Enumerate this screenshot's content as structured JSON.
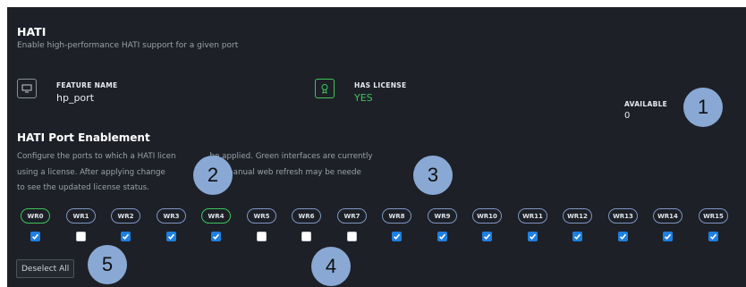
{
  "header": {
    "title": "HATI",
    "subtitle": "Enable high-performance HATI support for a given port"
  },
  "feature": {
    "name_label": "FEATURE NAME",
    "name_value": "hp_port",
    "license_label": "HAS LICENSE",
    "license_value": "YES",
    "available_label": "AVAILABLE",
    "available_value": "0"
  },
  "enablement": {
    "title": "HATI Port Enablement",
    "desc_line1": "Configure the ports to which a HATI licen",
    "desc_line1b": "be applied. Green interfaces are currently",
    "desc_line2": "using a license. After applying change",
    "desc_line2b": "onal manual web refresh may be neede",
    "desc_line3": "to see the updated license status."
  },
  "ports": [
    {
      "label": "WR0",
      "checked": true,
      "licensed": true
    },
    {
      "label": "WR1",
      "checked": false,
      "licensed": false
    },
    {
      "label": "WR2",
      "checked": true,
      "licensed": false
    },
    {
      "label": "WR3",
      "checked": true,
      "licensed": false
    },
    {
      "label": "WR4",
      "checked": true,
      "licensed": true
    },
    {
      "label": "WR5",
      "checked": false,
      "licensed": false
    },
    {
      "label": "WR6",
      "checked": false,
      "licensed": false
    },
    {
      "label": "WR7",
      "checked": false,
      "licensed": false
    },
    {
      "label": "WR8",
      "checked": true,
      "licensed": false
    },
    {
      "label": "WR9",
      "checked": true,
      "licensed": false
    },
    {
      "label": "WR10",
      "checked": true,
      "licensed": false
    },
    {
      "label": "WR11",
      "checked": true,
      "licensed": false
    },
    {
      "label": "WR12",
      "checked": true,
      "licensed": false
    },
    {
      "label": "WR13",
      "checked": true,
      "licensed": false
    },
    {
      "label": "WR14",
      "checked": true,
      "licensed": false
    },
    {
      "label": "WR15",
      "checked": true,
      "licensed": false
    }
  ],
  "deselect_label": "Deselect All",
  "callouts": [
    "1",
    "2",
    "3",
    "4",
    "5"
  ],
  "colors": {
    "background": "#1d2027",
    "licensed_green": "#3ec45a",
    "pill_border": "#7e95c2",
    "checkbox_blue": "#1e7fe0",
    "callout": "#89a9d4"
  }
}
